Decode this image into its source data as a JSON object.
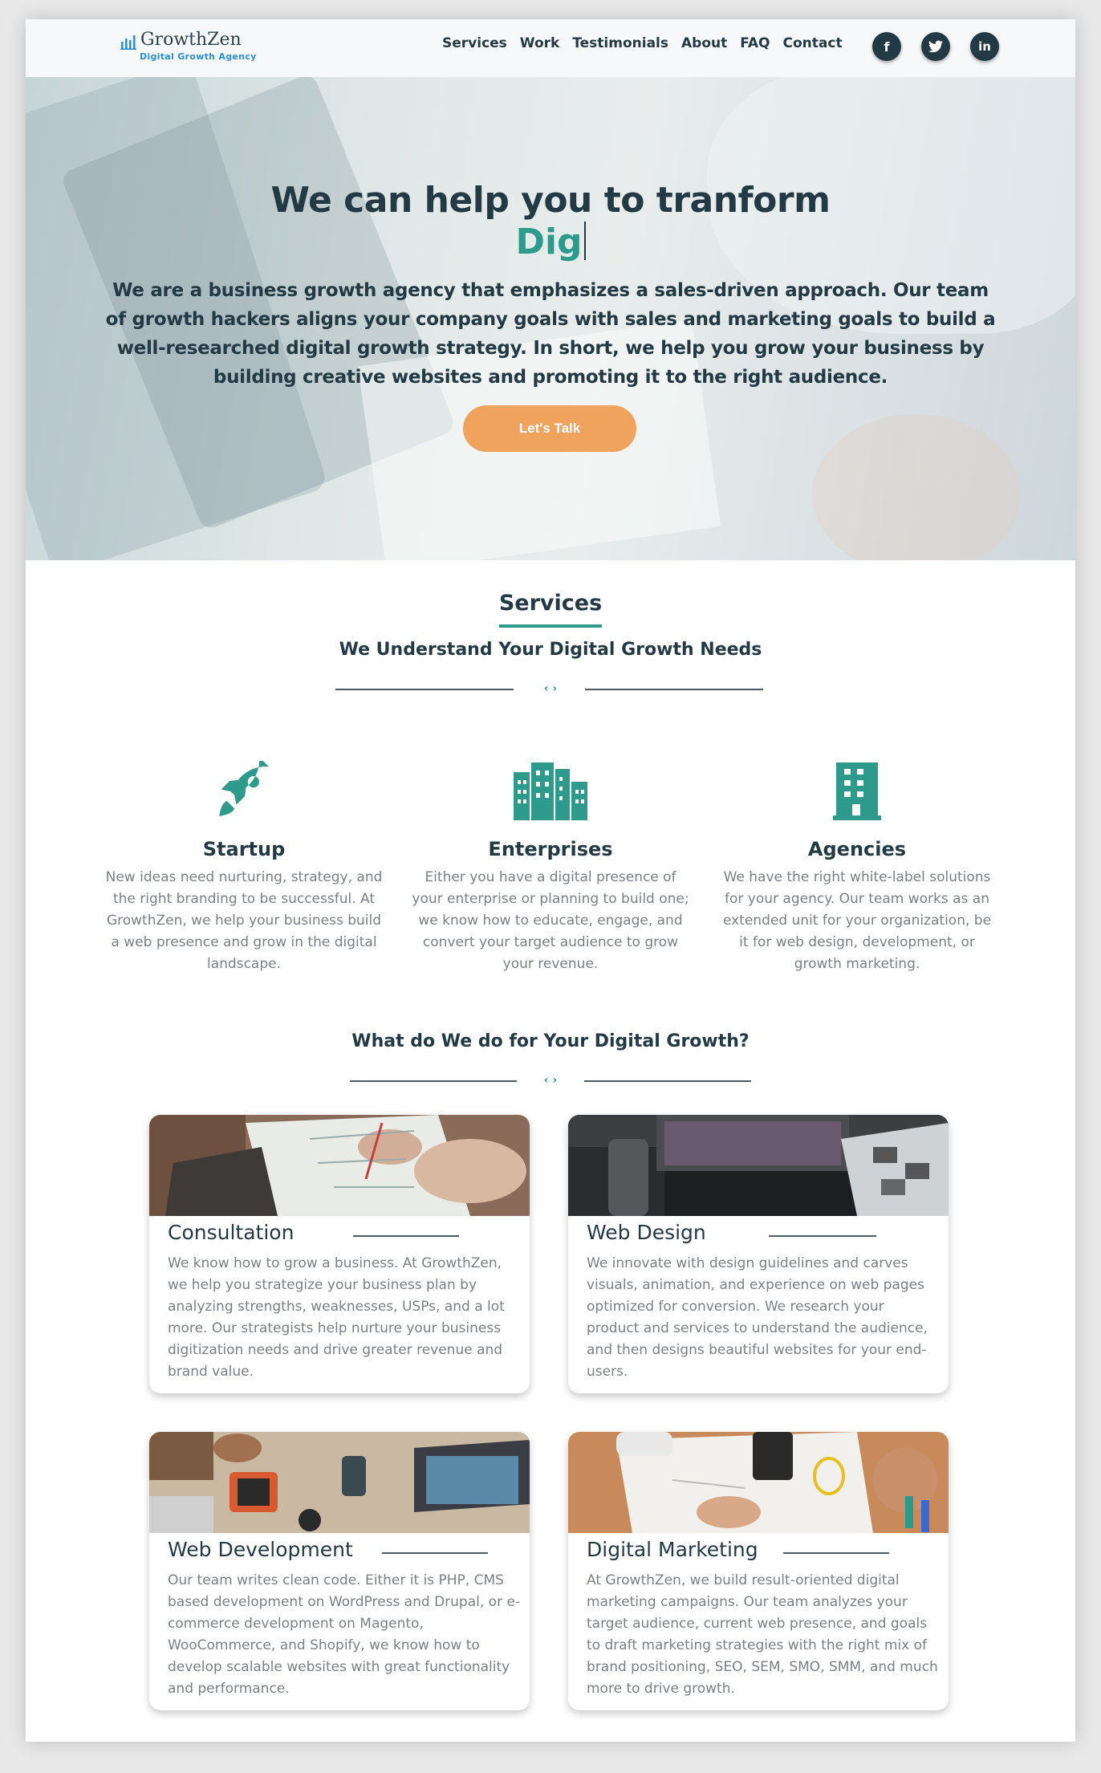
{
  "header": {
    "logo_title": "GrowthZen",
    "logo_subtitle": "Digital Growth Agency",
    "nav": [
      "Services",
      "Work",
      "Testimonials",
      "About",
      "FAQ",
      "Contact"
    ],
    "social": [
      {
        "icon": "facebook-icon",
        "glyph": "f"
      },
      {
        "icon": "twitter-icon",
        "glyph": "t"
      },
      {
        "icon": "linkedin-icon",
        "glyph": "in"
      }
    ]
  },
  "hero": {
    "title": "We can help you to tranform",
    "typed": "Dig",
    "description": "We are a business growth agency that emphasizes a sales-driven approach. Our team of growth hackers aligns your company goals with sales and marketing goals to build a well-researched digital growth strategy. In short, we help you grow your business by building creative websites and promoting it to the right audience.",
    "cta": "Let's Talk"
  },
  "services": {
    "title": "Services",
    "subtitle": "We Understand Your Digital Growth Needs",
    "divider_icon": "‹ ›",
    "items": [
      {
        "icon": "rocket-icon",
        "title": "Startup",
        "desc": "New ideas need nurturing, strategy, and the right branding to be successful. At GrowthZen, we help your business build a web presence and grow in the digital landscape."
      },
      {
        "icon": "city-buildings-icon",
        "title": "Enterprises",
        "desc": "Either you have a digital presence of your enterprise or planning to build one; we know how to educate, engage, and convert your target audience to grow your revenue."
      },
      {
        "icon": "office-building-icon",
        "title": "Agencies",
        "desc": "We have the right white-label solutions for your agency. Our team works as an extended unit for your organization, be it for web design, development, or growth marketing."
      }
    ]
  },
  "what_we_do": {
    "title": "What do We do for Your Digital Growth?",
    "divider_icon": "‹ ›",
    "cards": [
      {
        "title": "Consultation",
        "desc": "We know how to grow a business. At GrowthZen, we help you strategize your business plan by analyzing strengths, weaknesses, USPs, and a lot more. Our strategists help nurture your business digitization needs and drive greater revenue and brand value."
      },
      {
        "title": "Web Design",
        "desc": "We innovate with design guidelines and carves visuals, animation, and experience on web pages optimized for conversion. We research your product and services to understand the audience, and then designs beautiful websites for your end-users."
      },
      {
        "title": "Web Development",
        "desc": "Our team writes clean code. Either it is PHP, CMS based development on WordPress and Drupal, or e-commerce development on Magento, WooCommerce, and Shopify, we know how to develop scalable websites with great functionality and performance."
      },
      {
        "title": "Digital Marketing",
        "desc": "At GrowthZen, we build result-oriented digital marketing campaigns. Our team analyzes your target audience, current web presence, and goals to draft marketing strategies with the right mix of brand positioning, SEO, SEM, SMO, SMM, and much more to drive growth."
      }
    ]
  },
  "colors": {
    "primary_dark": "#233a45",
    "accent_teal": "#2e9a8b",
    "cta_orange": "#f0a35d",
    "logo_blue": "#2a8fcf"
  }
}
